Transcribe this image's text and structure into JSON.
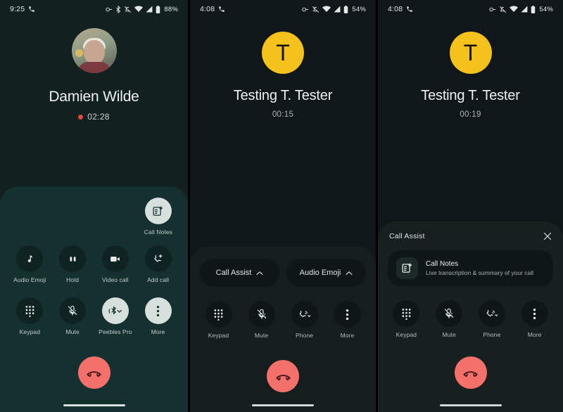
{
  "panels": [
    {
      "id": "panel-ongoing-call-damien",
      "statusbar": {
        "time": "9:25",
        "call_icon": "phone-in-call-icon",
        "right_icons": [
          "no-sim-icon",
          "bluetooth-icon",
          "ringer-silent-icon",
          "wifi-icon",
          "cellular-signal-icon",
          "battery-icon"
        ],
        "battery": "88%"
      },
      "caller": {
        "avatar_type": "photo",
        "name": "Damien Wilde",
        "timer": "02:28",
        "recording_dot": true
      },
      "notes_control": {
        "label": "Call Notes",
        "icon": "call-notes-icon",
        "active": true
      },
      "row_a": [
        {
          "label": "Audio Emoji",
          "icon": "music-note-icon",
          "active": false
        },
        {
          "label": "Hold",
          "icon": "pause-icon",
          "active": false
        },
        {
          "label": "Video call",
          "icon": "video-camera-icon",
          "active": false
        },
        {
          "label": "Add call",
          "icon": "add-call-icon",
          "active": false
        }
      ],
      "row_b": [
        {
          "label": "Keypad",
          "icon": "dialpad-icon",
          "active": false
        },
        {
          "label": "Mute",
          "icon": "mic-off-icon",
          "active": false
        },
        {
          "label": "Peebles Pro",
          "icon": "bluetooth-audio-icon",
          "active": true
        },
        {
          "label": "More",
          "icon": "more-vertical-icon",
          "active": true
        }
      ],
      "end_call": {
        "label": "End call",
        "icon": "end-call-icon"
      }
    },
    {
      "id": "panel-ongoing-call-tester-collapsed",
      "statusbar": {
        "time": "4:08",
        "call_icon": "phone-in-call-icon",
        "right_icons": [
          "no-sim-icon",
          "ringer-silent-icon",
          "wifi-icon",
          "cellular-signal-icon",
          "battery-icon"
        ],
        "battery": "54%"
      },
      "caller": {
        "avatar_type": "letter",
        "avatar_letter": "T",
        "avatar_color": "#f5c21b",
        "name": "Testing T. Tester",
        "timer": "00:15",
        "recording_dot": false
      },
      "pills": [
        {
          "label": "Call Assist",
          "icon": "chevron-up-icon"
        },
        {
          "label": "Audio Emoji",
          "icon": "chevron-up-icon"
        }
      ],
      "row_c": [
        {
          "label": "Keypad",
          "icon": "dialpad-icon",
          "active": false
        },
        {
          "label": "Mute",
          "icon": "mic-off-icon",
          "active": false
        },
        {
          "label": "Phone",
          "icon": "phone-audio-dropdown-icon",
          "active": false
        },
        {
          "label": "More",
          "icon": "more-vertical-icon",
          "active": false
        }
      ],
      "end_call": {
        "label": "End call",
        "icon": "end-call-icon"
      }
    },
    {
      "id": "panel-ongoing-call-tester-assist-expanded",
      "statusbar": {
        "time": "4:08",
        "call_icon": "phone-in-call-icon",
        "right_icons": [
          "no-sim-icon",
          "ringer-silent-icon",
          "wifi-icon",
          "cellular-signal-icon",
          "battery-icon"
        ],
        "battery": "54%"
      },
      "caller": {
        "avatar_type": "letter",
        "avatar_letter": "T",
        "avatar_color": "#f5c21b",
        "name": "Testing T. Tester",
        "timer": "00:19",
        "recording_dot": false
      },
      "assist": {
        "title": "Call Assist",
        "close_icon": "close-icon",
        "card": {
          "icon": "call-notes-icon",
          "title": "Call Notes",
          "subtitle": "Live transcription & summary of your call"
        }
      },
      "row_c": [
        {
          "label": "Keypad",
          "icon": "dialpad-icon",
          "active": false
        },
        {
          "label": "Mute",
          "icon": "mic-off-icon",
          "active": false
        },
        {
          "label": "Phone",
          "icon": "phone-audio-dropdown-icon",
          "active": false
        },
        {
          "label": "More",
          "icon": "more-vertical-icon",
          "active": false
        }
      ],
      "end_call": {
        "label": "End call",
        "icon": "end-call-icon"
      }
    }
  ],
  "colors": {
    "panel1_bg": "#12201f",
    "panel1_sheet": "#14302f",
    "panel23_bg": "#10171b",
    "panel23_sheet": "#151d1d",
    "end_call_red": "#f4706a",
    "avatar_yellow": "#f5c21b",
    "recording_red": "#e8483c",
    "active_chip": "#d6e0dc"
  }
}
